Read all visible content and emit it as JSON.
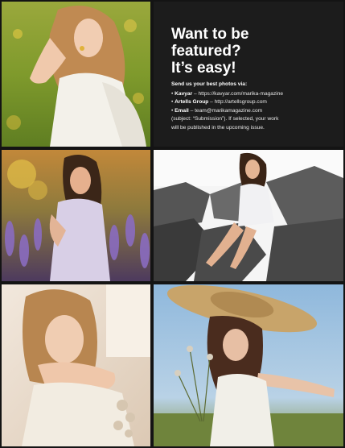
{
  "promo": {
    "headline_lines": [
      "Want to be",
      "featured?",
      "It’s easy!"
    ],
    "lead": "Send us your best photos via:",
    "channels": [
      {
        "bullet": "•",
        "name": "Kavyar",
        "separator": " – ",
        "detail": "https://kavyar.com/marika-magazine"
      },
      {
        "bullet": "•",
        "name": "Artells Group",
        "separator": " – ",
        "detail": "http://artellsgroup.com"
      },
      {
        "bullet": "•",
        "name": "Email",
        "separator": " – ",
        "detail": "team@marikamagazine.com"
      }
    ],
    "note_lines": [
      "(subject: “Submission”). If selected, your work",
      "will be published in the upcoming issue."
    ]
  },
  "photos": [
    {
      "id": "portrait-sunflower-field",
      "palette": [
        "#8fa63a",
        "#c9b24a",
        "#f2d9c4"
      ]
    },
    {
      "id": "portrait-lavender-field",
      "palette": [
        "#6b4e8a",
        "#c98a3a",
        "#e8c9b0"
      ]
    },
    {
      "id": "portrait-on-rocks",
      "palette": [
        "#f4f4f4",
        "#3c3c3c",
        "#e6d6c8"
      ]
    },
    {
      "id": "portrait-indoor-sitting",
      "palette": [
        "#efe6dc",
        "#c79b6a",
        "#f3dcc8"
      ]
    },
    {
      "id": "portrait-straw-hat-meadow",
      "palette": [
        "#9cc3e2",
        "#6f8a3d",
        "#c9a86a"
      ]
    }
  ]
}
